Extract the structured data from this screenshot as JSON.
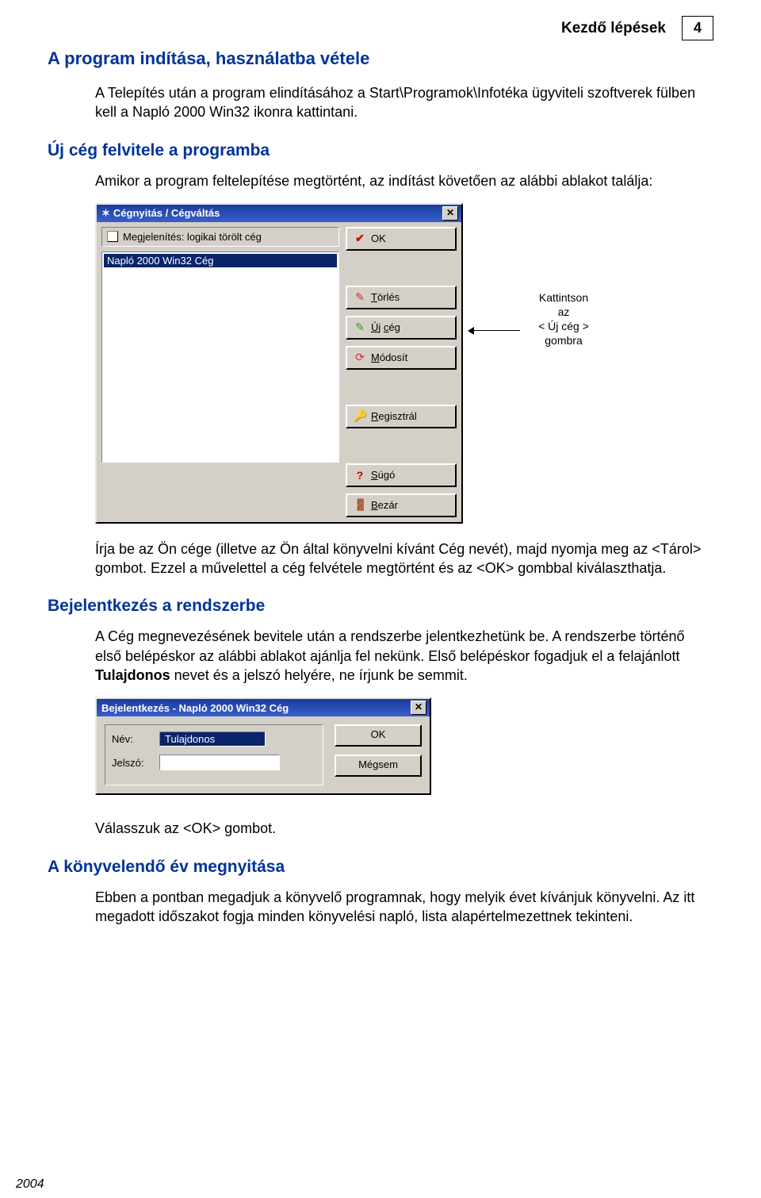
{
  "header": {
    "title": "Kezdő lépések",
    "page": "4"
  },
  "h1": "A program indítása, használatba vétele",
  "p1": "A Telepítés után a program elindításához a Start\\Programok\\Infotéka ügyviteli szoftverek fülben kell a Napló 2000 Win32 ikonra  kattintani.",
  "h2": "Új cég felvitele a programba",
  "p2": "Amikor a program feltelepítése megtörtént, az indítást követően az alábbi ablakot találja:",
  "dialog1": {
    "title": "Cégnyitás / Cégváltás",
    "checkbox_label": "Megjelenítés: logikai törölt cég",
    "list_item": "Napló 2000 Win32 Cég",
    "buttons": {
      "ok": "OK",
      "torles_pre": "T",
      "torles_rest": "örlés",
      "ujceg_pre": "Ú",
      "ujceg_mid": "j ",
      "ujceg_u": "c",
      "ujceg_rest": "ég",
      "modosit_pre": "M",
      "modosit_rest": "ódosít",
      "regisztral_pre": "R",
      "regisztral_rest": "egisztrál",
      "sugo_pre": "S",
      "sugo_rest": "úgó",
      "bezar_pre": "B",
      "bezar_rest": "ezár"
    }
  },
  "callout": {
    "l1": "Kattintson",
    "l2": "az",
    "l3": "< Új cég >",
    "l4": "gombra"
  },
  "p3": "Írja be az Ön cége (illetve az Ön által könyvelni kívánt Cég nevét), majd nyomja meg az <Tárol> gombot. Ezzel a művelettel a cég felvétele megtörtént és az <OK> gombbal kiválaszthatja.",
  "h3": "Bejelentkezés a rendszerbe",
  "p4a": "A Cég megnevezésének bevitele után a rendszerbe jelentkezhetünk be. A rendszerbe történő első belépéskor az alábbi ablakot ajánlja fel nekünk. Első belépéskor fogadjuk el a felajánlott ",
  "p4b": "Tulajdonos",
  "p4c": " nevet és a jelszó helyére, ne írjunk be semmit.",
  "dialog2": {
    "title": "Bejelentkezés - Napló 2000 Win32 Cég",
    "name_label": "Név:",
    "name_value": "Tulajdonos",
    "pass_label": "Jelszó:",
    "ok": "OK",
    "cancel": "Mégsem"
  },
  "p5": "Válasszuk az <OK> gombot.",
  "h4": "A könyvelendő év megnyitása",
  "p6": "Ebben a pontban megadjuk a könyvelő programnak, hogy melyik évet kívánjuk könyvelni. Az itt megadott időszakot fogja minden könyvelési napló, lista alapértelmezettnek tekinteni.",
  "footer_year": "2004"
}
